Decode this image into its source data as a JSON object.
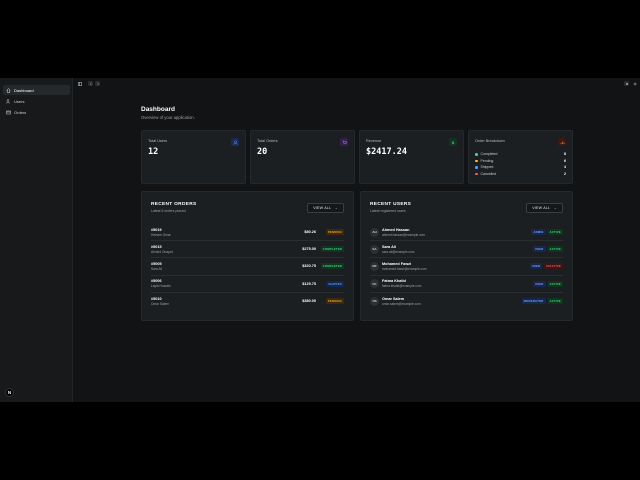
{
  "sidebar": {
    "items": [
      {
        "label": "Dashboard",
        "icon": "home-icon",
        "active": true
      },
      {
        "label": "Users",
        "icon": "users-icon",
        "active": false
      },
      {
        "label": "Orders",
        "icon": "orders-icon",
        "active": false
      }
    ],
    "logo": "N"
  },
  "page": {
    "title": "Dashboard",
    "subtitle": "Overview of your application."
  },
  "stats": [
    {
      "label": "Total Users",
      "value": "12",
      "icon": "users-icon",
      "color": "#4f7cff",
      "bg": "#1c2a52"
    },
    {
      "label": "Total Orders",
      "value": "20",
      "icon": "cart-icon",
      "color": "#b56cff",
      "bg": "#33204a"
    },
    {
      "label": "Revenue",
      "value": "$2417.24",
      "icon": "dollar-icon",
      "color": "#3ddc84",
      "bg": "#12331f"
    }
  ],
  "breakdown": {
    "label": "Order Breakdown",
    "icon": "chart-icon",
    "rows": [
      {
        "label": "Completed",
        "value": "8",
        "color": "#3ddc84"
      },
      {
        "label": "Pending",
        "value": "6",
        "color": "#f5c518"
      },
      {
        "label": "Shipped",
        "value": "4",
        "color": "#5b9bff"
      },
      {
        "label": "Cancelled",
        "value": "2",
        "color": "#ff5a5a"
      }
    ]
  },
  "orders_panel": {
    "title": "RECENT ORDERS",
    "subtitle": "Latest 5 orders placed",
    "view_all": "VIEW ALL",
    "rows": [
      {
        "id": "#5019",
        "name": "Hisham Omar",
        "amount": "$80.26",
        "status": "PENDING",
        "kind": "pending"
      },
      {
        "id": "#5015",
        "name": "Ahmed Ouaycd",
        "amount": "$275.00",
        "status": "COMPLETED",
        "kind": "completed"
      },
      {
        "id": "#5005",
        "name": "Sara Ali",
        "amount": "$320.75",
        "status": "COMPLETED",
        "kind": "completed"
      },
      {
        "id": "#5006",
        "name": "Layla Hussein",
        "amount": "$129.75",
        "status": "SHIPPED",
        "kind": "shipped"
      },
      {
        "id": "#5010",
        "name": "Omar Salem",
        "amount": "$380.00",
        "status": "PENDING",
        "kind": "pending"
      }
    ]
  },
  "users_panel": {
    "title": "RECENT USERS",
    "subtitle": "Latest registered users",
    "view_all": "VIEW ALL",
    "rows": [
      {
        "initials": "AH",
        "name": "Ahmed Hassan",
        "email": "ahmed.hassan@example.com",
        "role": "ADMIN",
        "status": "ACTIVE",
        "kind": "active"
      },
      {
        "initials": "SA",
        "name": "Sara Ali",
        "email": "sara.ali@example.com",
        "role": "USER",
        "status": "ACTIVE",
        "kind": "active"
      },
      {
        "initials": "MF",
        "name": "Mohamed Fawzi",
        "email": "mohamed.fawzi@example.com",
        "role": "USER",
        "status": "INACTIVE",
        "kind": "inactive"
      },
      {
        "initials": "FK",
        "name": "Fatma Khalid",
        "email": "fatma.khalid@example.com",
        "role": "USER",
        "status": "ACTIVE",
        "kind": "active"
      },
      {
        "initials": "OS",
        "name": "Omar Salem",
        "email": "omar.salem@example.com",
        "role": "MODERATOR",
        "status": "ACTIVE",
        "kind": "active"
      }
    ]
  }
}
